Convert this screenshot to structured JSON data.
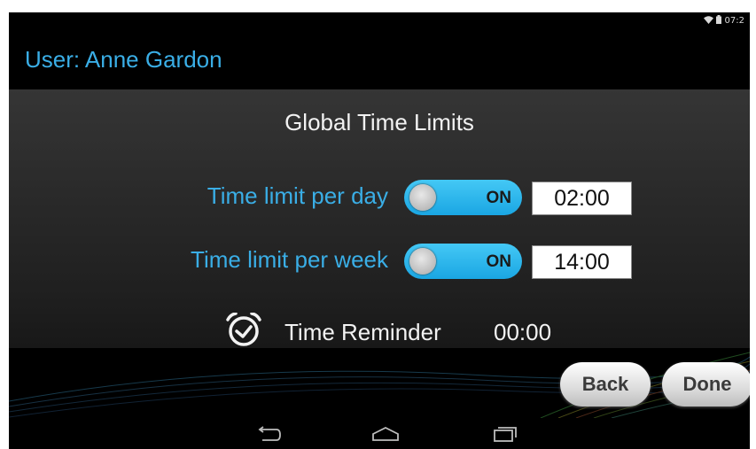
{
  "status_bar": {
    "time": "07:2",
    "icons": [
      "wifi-icon",
      "battery-icon"
    ]
  },
  "user_header": "User: Anne Gardon",
  "panel": {
    "title": "Global Time Limits",
    "rows": [
      {
        "label": "Time limit per day",
        "toggle": "ON",
        "value": "02:00"
      },
      {
        "label": "Time limit per week",
        "toggle": "ON",
        "value": "14:00"
      }
    ],
    "reminder": {
      "label": "Time Reminder",
      "value": "00:00",
      "icon": "alarm-clock-icon"
    }
  },
  "buttons": {
    "back": "Back",
    "done": "Done"
  },
  "navbar": {
    "icons": [
      "back-nav-icon",
      "home-nav-icon",
      "recents-nav-icon"
    ]
  },
  "colors": {
    "accent": "#3aaee6",
    "toggle": "#2bb3ec",
    "background": "#000000"
  }
}
